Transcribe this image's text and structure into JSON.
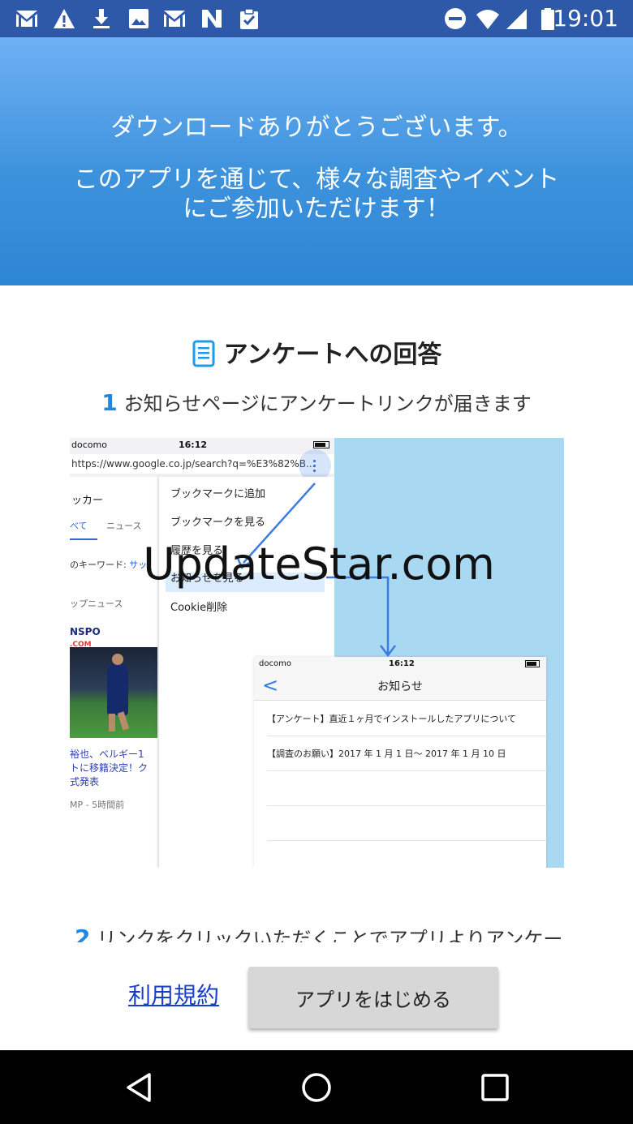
{
  "status_bar": {
    "time": "19:01",
    "left_icons": [
      "gmail-icon",
      "warning-icon",
      "download-icon",
      "image-icon",
      "gmail-icon",
      "app-n-icon",
      "clipboard-check-icon"
    ],
    "right_icons": [
      "do-not-disturb-icon",
      "wifi-icon",
      "signal-icon",
      "battery-icon"
    ]
  },
  "header": {
    "line1": "ダウンロードありがとうございます。",
    "line2a": "このアプリを通じて、様々な調査やイベント",
    "line2b": "にご参加いただけます！"
  },
  "section": {
    "title": "アンケートへの回答",
    "title_icon": "document-icon",
    "step1_num": "1",
    "step1_text": "お知らせページにアンケートリンクが届きます",
    "step2_num": "2",
    "step2_text": "リンクをクリックいただくことでアプリよりアンケー"
  },
  "illustration": {
    "phone1": {
      "carrier": "docomo",
      "time": "16:12",
      "url": "https://www.google.co.jp/search?q=%E3%82%B...",
      "query": "ッカー",
      "tab_all": "べて",
      "tab_news": "ニュース",
      "keyword_label": "のキーワード:",
      "keyword_value": "サッ",
      "top_news": "ップニュース",
      "logo_text": "NSPO",
      "logo_sub": ".COM",
      "headline": "裕也、ベルギー1\nトに移籍決定！ク\n式発表",
      "source": "MP - 5時間前",
      "menu": [
        "ブックマークに追加",
        "ブックマークを見る",
        "履歴を見る",
        "お知らせを見る",
        "Cookie削除"
      ]
    },
    "phone2": {
      "carrier": "docomo",
      "time": "16:12",
      "title": "お知らせ",
      "rows": [
        "【アンケート】直近１ヶ月でインストールしたアプリについて",
        "【調査のお願い】2017 年 1 月 1 日〜 2017 年 1 月 10 日",
        "",
        "",
        ""
      ]
    }
  },
  "watermark": "UpdateStar.com",
  "footer": {
    "terms_label": "利用規約",
    "start_label": "アプリをはじめる"
  },
  "nav": {
    "back": "back-icon",
    "home": "home-icon",
    "recents": "recents-icon"
  }
}
